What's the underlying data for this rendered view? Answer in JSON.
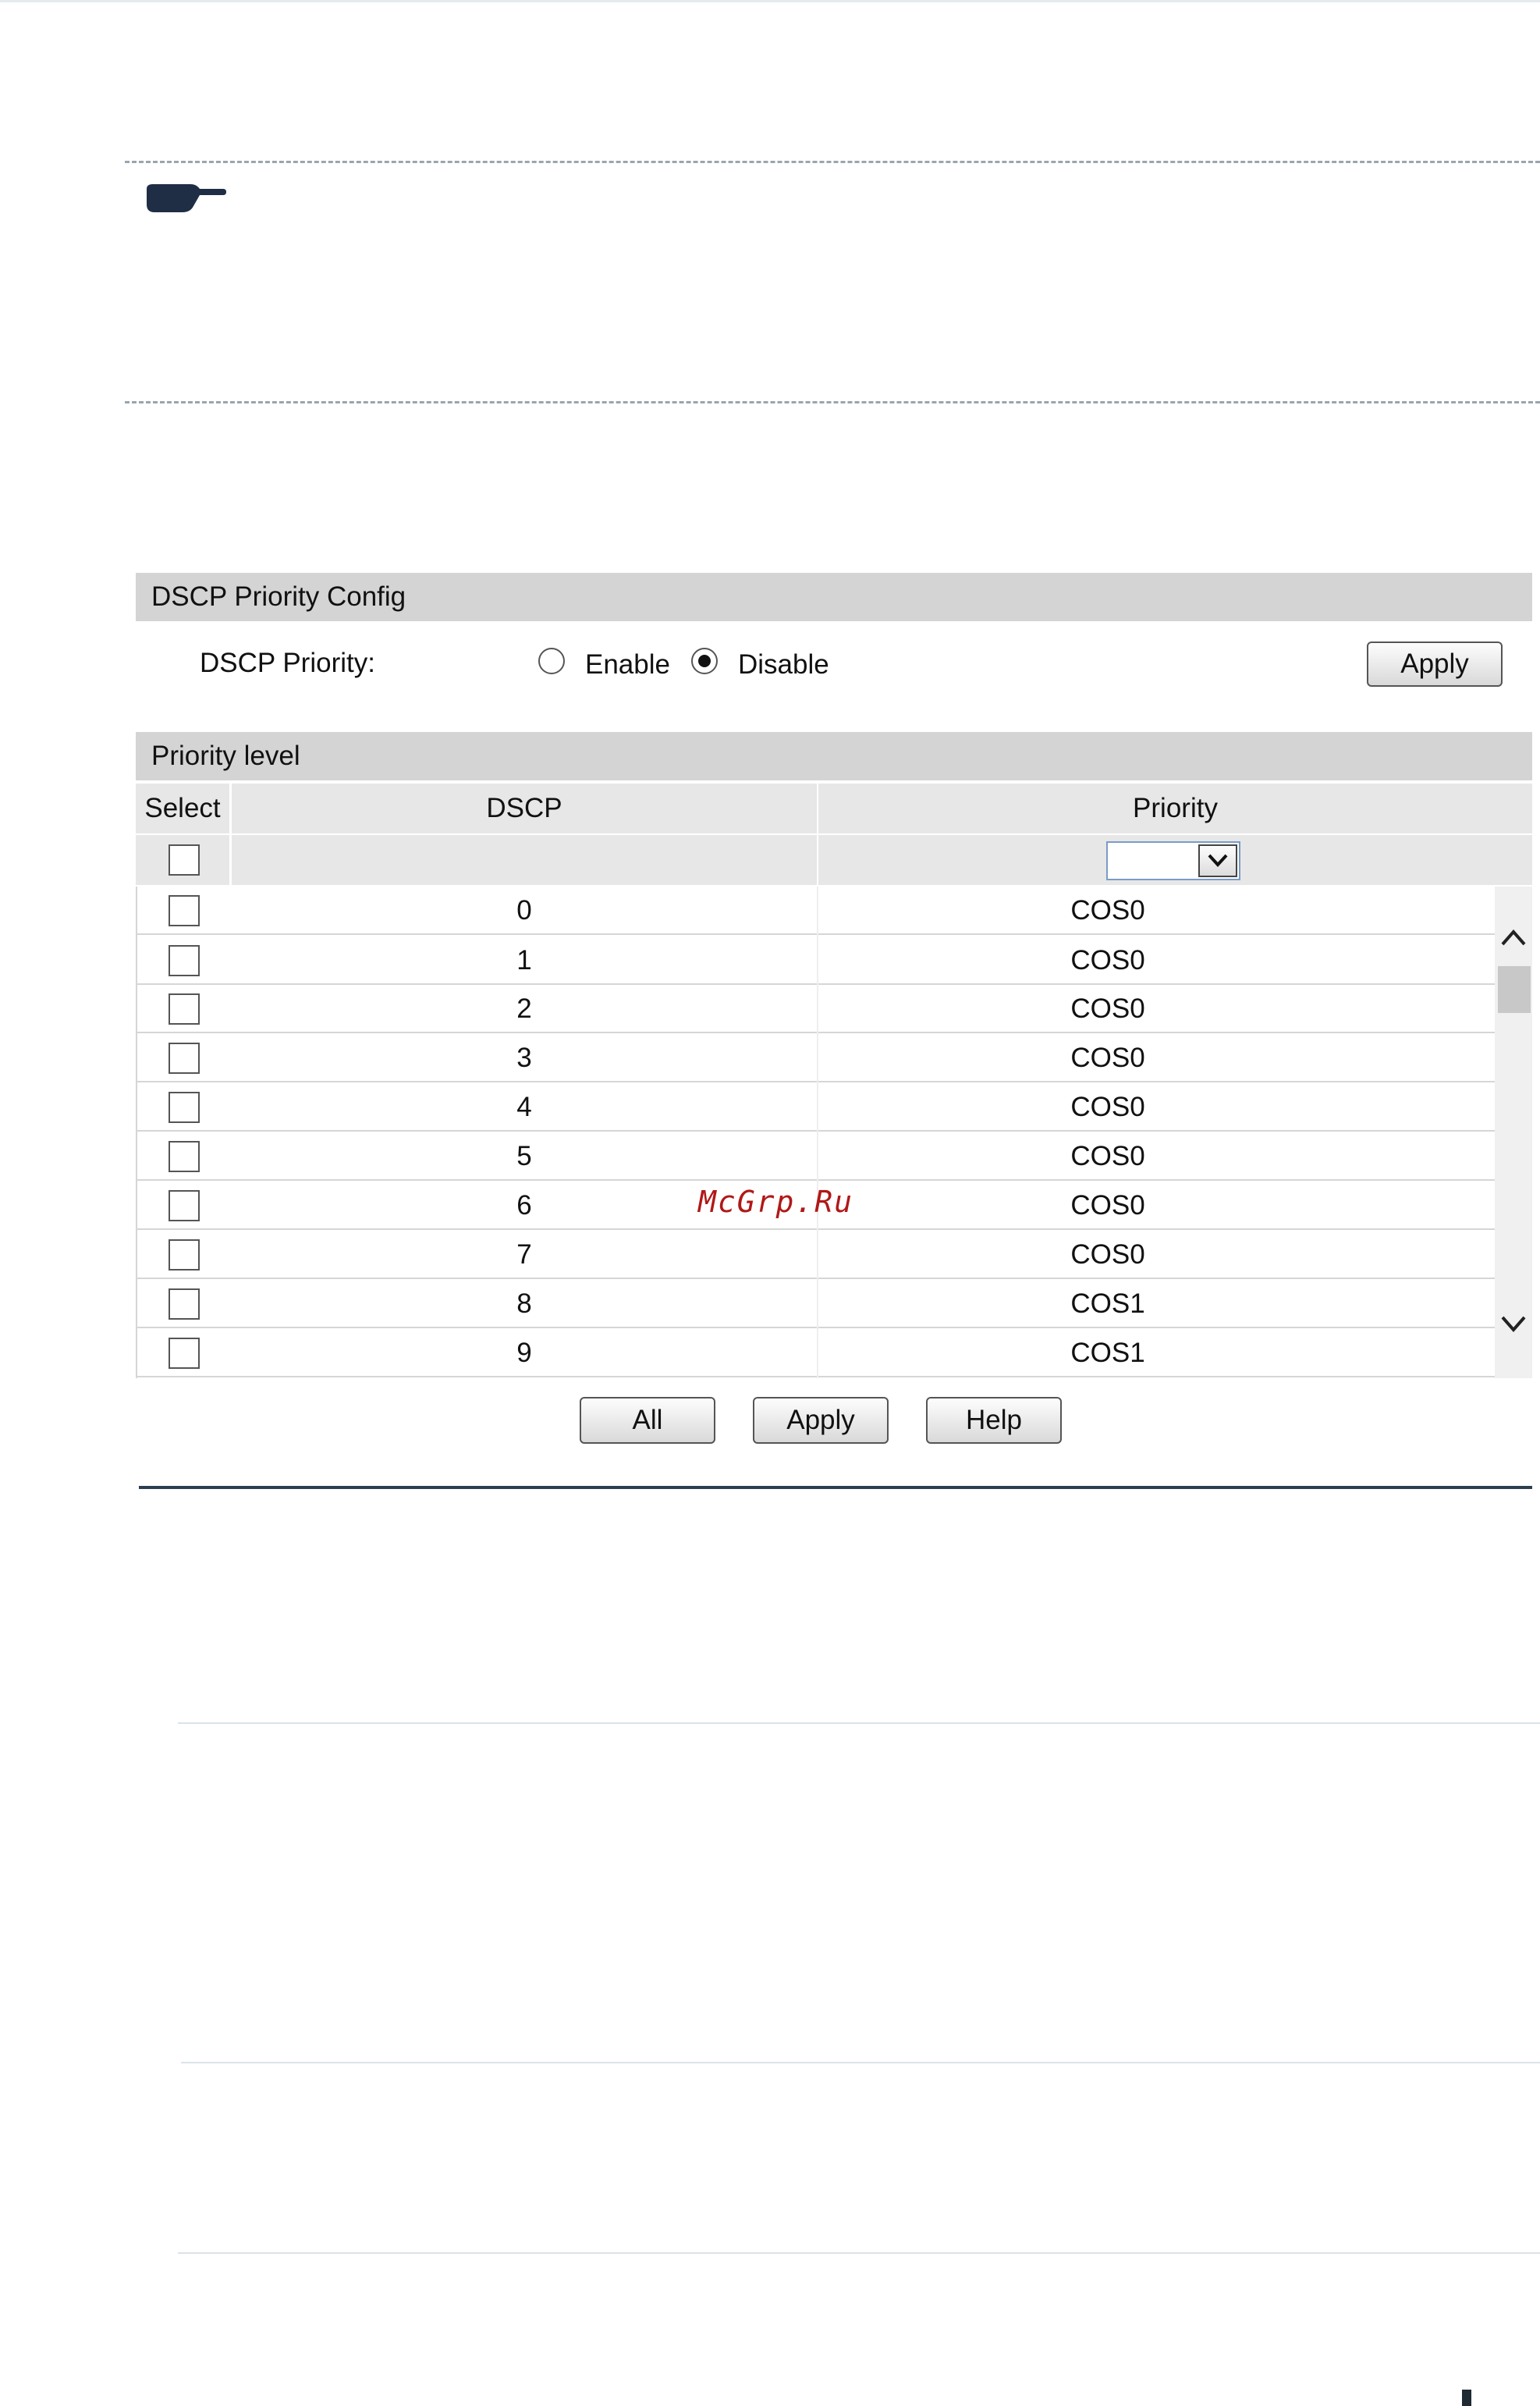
{
  "dscp_config": {
    "title": "DSCP Priority Config",
    "label": "DSCP Priority:",
    "enable_label": "Enable",
    "disable_label": "Disable",
    "selected": "Disable",
    "apply_label": "Apply"
  },
  "priority_level": {
    "title": "Priority level",
    "columns": [
      "Select",
      "DSCP",
      "Priority"
    ],
    "priority_filter_value": "",
    "rows": [
      {
        "dscp": "0",
        "priority": "COS0"
      },
      {
        "dscp": "1",
        "priority": "COS0"
      },
      {
        "dscp": "2",
        "priority": "COS0"
      },
      {
        "dscp": "3",
        "priority": "COS0"
      },
      {
        "dscp": "4",
        "priority": "COS0"
      },
      {
        "dscp": "5",
        "priority": "COS0"
      },
      {
        "dscp": "6",
        "priority": "COS0"
      },
      {
        "dscp": "7",
        "priority": "COS0"
      },
      {
        "dscp": "8",
        "priority": "COS1"
      },
      {
        "dscp": "9",
        "priority": "COS1"
      }
    ],
    "buttons": {
      "all": "All",
      "apply": "Apply",
      "help": "Help"
    }
  },
  "watermark": "McGrp.Ru",
  "icons": {
    "note": "pointing-hand-icon",
    "scroll_up": "chevron-up-icon",
    "scroll_down": "chevron-down-icon",
    "dropdown": "chevron-down-icon"
  },
  "colors": {
    "panel_header": "#d4d4d4",
    "table_header": "#e7e7e7",
    "section_rule": "#2c3e50",
    "watermark": "#b01818"
  }
}
